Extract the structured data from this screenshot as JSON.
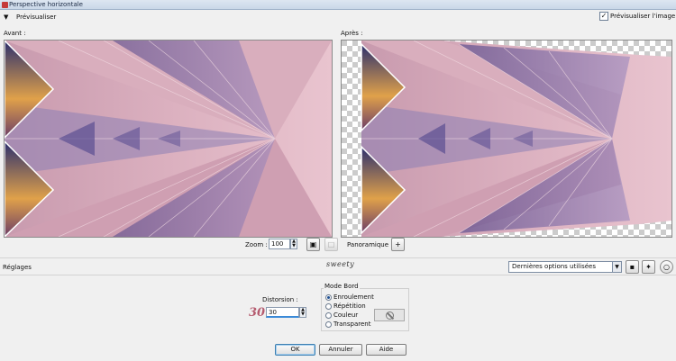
{
  "window": {
    "title": "Perspective horizontale"
  },
  "preview": {
    "toggle_label": "Prévisualiser",
    "checkbox_label": "Prévisualiser l'image",
    "checked": true
  },
  "panels": {
    "before_label": "Avant :",
    "after_label": "Après :"
  },
  "zoom": {
    "label": "Zoom :",
    "value": "100",
    "pan_label": "Panoramique :"
  },
  "settings": {
    "label": "Réglages",
    "logo": "sweety",
    "preset_value": "Dernières options utilisées"
  },
  "distortion": {
    "label": "Distorsion :",
    "value": "30",
    "annotation": "30"
  },
  "edge_mode": {
    "title": "Mode Bord",
    "options": [
      {
        "label": "Enroulement",
        "selected": true
      },
      {
        "label": "Répétition",
        "selected": false
      },
      {
        "label": "Couleur",
        "selected": false
      },
      {
        "label": "Transparent",
        "selected": false
      }
    ]
  },
  "buttons": {
    "ok": "OK",
    "cancel": "Annuler",
    "help": "Aide"
  },
  "colors": {
    "accent": "#3c7fb1",
    "pink": "#d7a7b7",
    "purple": "#5d4f8c",
    "annotation": "#b55a6e"
  }
}
